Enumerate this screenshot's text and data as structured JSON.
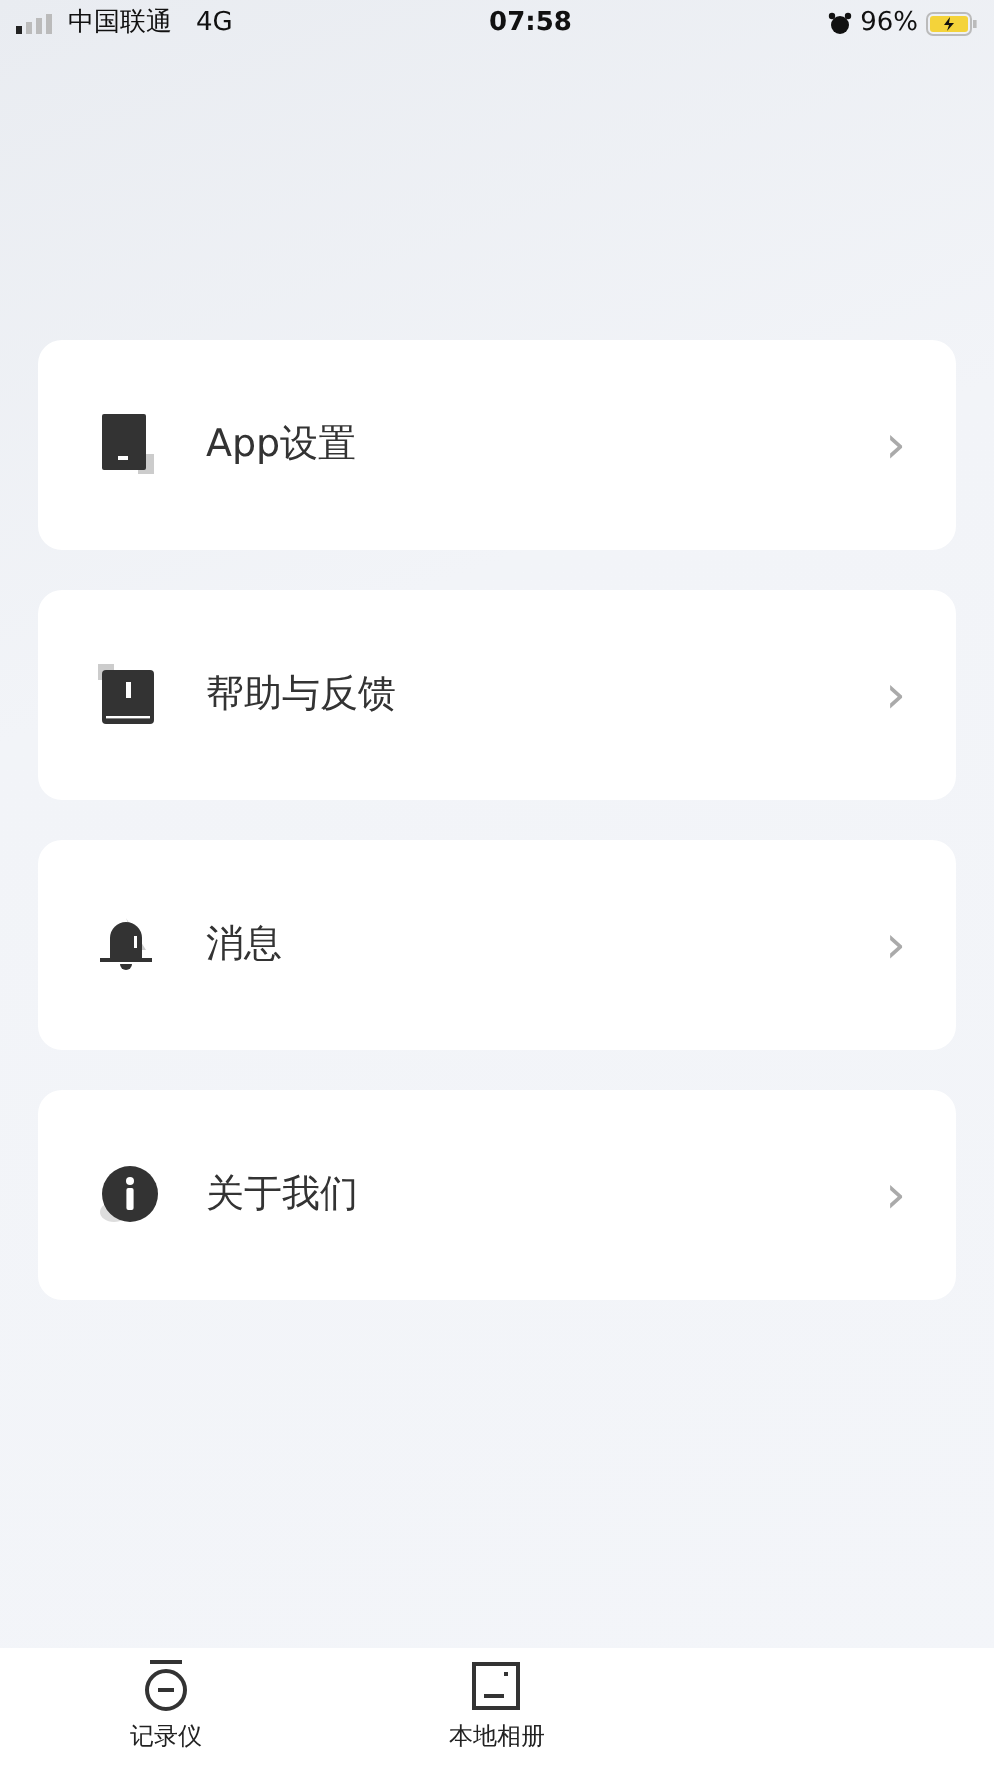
{
  "status_bar": {
    "carrier": "中国联通",
    "network": "4G",
    "time": "07:58",
    "battery": "96%"
  },
  "menu": [
    {
      "label": "App设置",
      "chevron": "›"
    },
    {
      "label": "帮助与反馈",
      "chevron": "›"
    },
    {
      "label": "消息",
      "chevron": "›"
    },
    {
      "label": "关于我们",
      "chevron": "›"
    }
  ],
  "tab_bar": [
    {
      "label": "记录仪"
    },
    {
      "label": "本地相册"
    }
  ]
}
